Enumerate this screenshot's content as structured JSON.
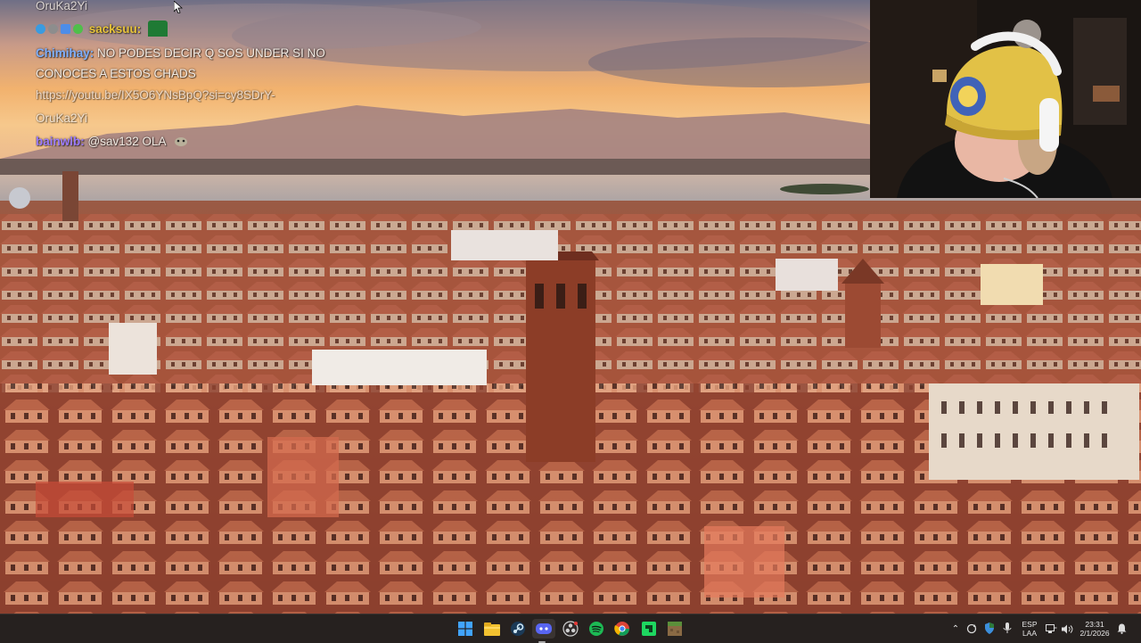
{
  "chat": {
    "messages": [
      {
        "user": "",
        "text": "OruKa2Yi",
        "kind": "continuation"
      },
      {
        "user": "sacksuu:",
        "text": "",
        "kind": "badge-message",
        "user_color": "#e8c43a",
        "emote": "green-block-emote"
      },
      {
        "user": "Chimihay:",
        "text": "NO PODES DECIR Q SOS UNDER SI NO CONOCES A ESTOS CHADS",
        "user_color": "#7fb0ff"
      },
      {
        "user": "",
        "text": "https://youtu.be/IX5O6YNsBpQ?si=cy8SDrY-",
        "kind": "link"
      },
      {
        "user": "",
        "text": "OruKa2Yi",
        "kind": "continuation"
      },
      {
        "user": "bainwlb:",
        "text": "@sav132 OLA",
        "user_color": "#9b7bff",
        "emote": "creature-emote"
      }
    ]
  },
  "webcam": {
    "label": "streamer-webcam"
  },
  "taskbar": {
    "apps": [
      {
        "name": "windows-start-icon",
        "color": "#3aa0ff"
      },
      {
        "name": "file-explorer-icon",
        "color": "#f2c230"
      },
      {
        "name": "steam-icon",
        "color": "#6fb7e6"
      },
      {
        "name": "discord-icon",
        "color": "#5865f2"
      },
      {
        "name": "obs-icon",
        "color": "#d0d0d0"
      },
      {
        "name": "spotify-icon",
        "color": "#1db954"
      },
      {
        "name": "chrome-icon",
        "color": "#e7b22a"
      },
      {
        "name": "green-app-icon",
        "color": "#1ed760"
      },
      {
        "name": "minecraft-icon",
        "color": "#6aa24a"
      }
    ],
    "tray": {
      "language_top": "ESP",
      "language_bottom": "LAA",
      "time": "23:31",
      "date": "2/1/2026"
    }
  }
}
